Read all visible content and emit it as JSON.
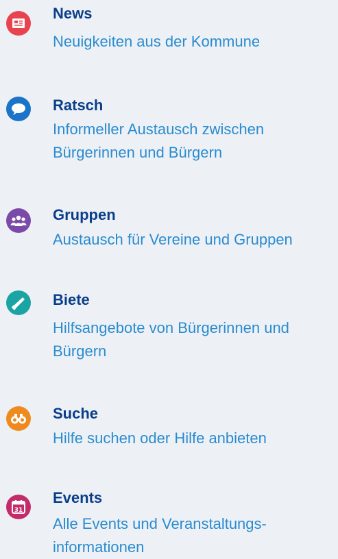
{
  "items": [
    {
      "key": "news",
      "icon": "newspaper-icon",
      "color": "#e8434f",
      "title": "News",
      "description": "Neuigkeiten aus der Kommune"
    },
    {
      "key": "ratsch",
      "icon": "chat-bubble-icon",
      "color": "#1c74c9",
      "title": "Ratsch",
      "description": "Informeller Austausch zwischen Bürgerinnen und Bürgern"
    },
    {
      "key": "gruppen",
      "icon": "group-icon",
      "color": "#7b4aa8",
      "title": "Gruppen",
      "description": "Austausch für Vereine und Gruppen"
    },
    {
      "key": "biete",
      "icon": "saw-icon",
      "color": "#1aa4a3",
      "title": "Biete",
      "description": "Hilfsangebote von Bürgerinnen und Bürgern"
    },
    {
      "key": "suche",
      "icon": "binoculars-icon",
      "color": "#ef8b1e",
      "title": "Suche",
      "description": "Hilfe suchen oder Hilfe anbieten"
    },
    {
      "key": "events",
      "icon": "calendar-icon",
      "color": "#c42b6a",
      "title": "Events",
      "description": "Alle Events und Veranstaltungs-informationen",
      "calendar_day": "31"
    }
  ]
}
